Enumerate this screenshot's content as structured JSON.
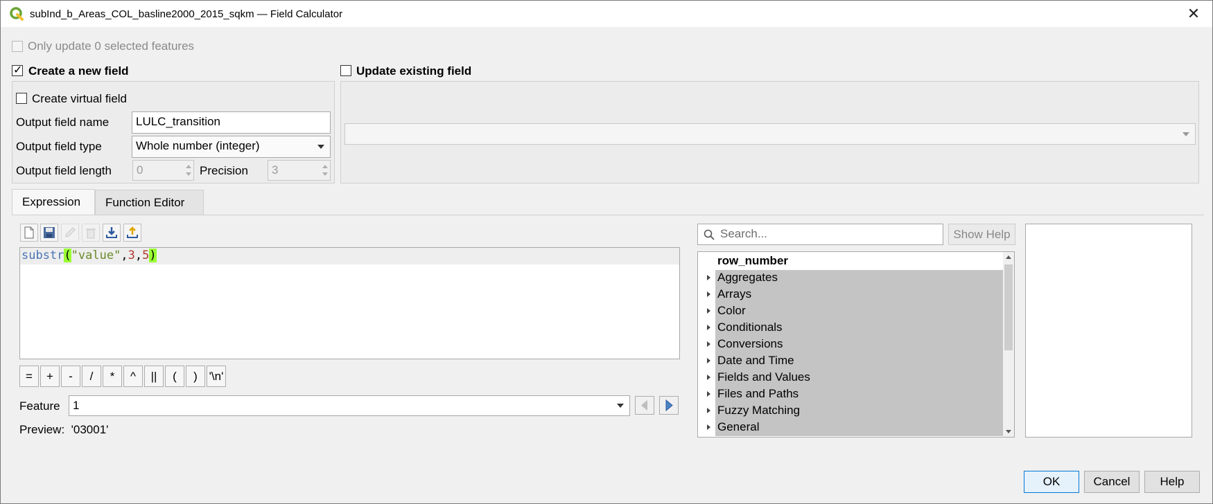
{
  "window": {
    "title": "subInd_b_Areas_COL_basline2000_2015_sqkm — Field Calculator"
  },
  "options": {
    "only_selected_label": "Only update 0 selected features",
    "create_new_field_label": "Create a new field",
    "create_new_field_checked": true,
    "update_existing_label": "Update existing field",
    "update_existing_checked": false,
    "create_virtual_label": "Create virtual field",
    "create_virtual_checked": false
  },
  "new_field": {
    "name_label": "Output field name",
    "name_value": "LULC_transition",
    "type_label": "Output field type",
    "type_value": "Whole number (integer)",
    "length_label": "Output field length",
    "length_value": "0",
    "precision_label": "Precision",
    "precision_value": "3"
  },
  "existing_field": {
    "selected_value": ""
  },
  "tabs": [
    {
      "label": "Expression",
      "active": true
    },
    {
      "label": "Function Editor",
      "active": false
    }
  ],
  "toolbar": {
    "icons": [
      "new-file-icon",
      "save-icon",
      "edit-icon",
      "delete-icon",
      "load-icon",
      "export-icon"
    ]
  },
  "expression": {
    "tokens": [
      {
        "text": "substr",
        "kind": "fn"
      },
      {
        "text": "(",
        "kind": "paren"
      },
      {
        "text": "\"value\"",
        "kind": "str"
      },
      {
        "text": ",",
        "kind": "plain"
      },
      {
        "text": "3",
        "kind": "num"
      },
      {
        "text": ",",
        "kind": "plain"
      },
      {
        "text": "5",
        "kind": "num"
      },
      {
        "text": ")",
        "kind": "paren"
      }
    ]
  },
  "operators": [
    "=",
    "+",
    "-",
    "/",
    "*",
    "^",
    "||",
    "(",
    ")",
    "'\\n'"
  ],
  "feature": {
    "label": "Feature",
    "value": "1"
  },
  "preview": {
    "text": "Preview:  '03001'"
  },
  "search": {
    "placeholder": "Search...",
    "show_help_label": "Show Help"
  },
  "function_tree": [
    {
      "label": "row_number",
      "group": false
    },
    {
      "label": "Aggregates",
      "group": true
    },
    {
      "label": "Arrays",
      "group": true
    },
    {
      "label": "Color",
      "group": true
    },
    {
      "label": "Conditionals",
      "group": true
    },
    {
      "label": "Conversions",
      "group": true
    },
    {
      "label": "Date and Time",
      "group": true
    },
    {
      "label": "Fields and Values",
      "group": true
    },
    {
      "label": "Files and Paths",
      "group": true
    },
    {
      "label": "Fuzzy Matching",
      "group": true
    },
    {
      "label": "General",
      "group": true
    }
  ],
  "dialog_buttons": {
    "ok": "OK",
    "cancel": "Cancel",
    "help": "Help"
  },
  "colors": {
    "qgis_green": "#7cb342",
    "bracket_highlight": "#99ff33",
    "default_button_border": "#0078d7"
  }
}
